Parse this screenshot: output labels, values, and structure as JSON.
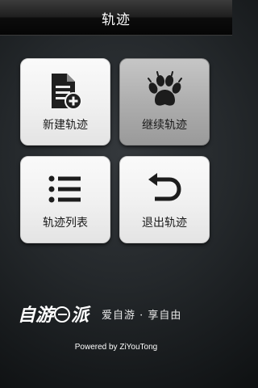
{
  "header": {
    "title": "轨迹"
  },
  "menu": [
    {
      "label": "新建轨迹",
      "icon": "new-document-icon"
    },
    {
      "label": "继续轨迹",
      "icon": "paw-print-icon"
    },
    {
      "label": "轨迹列表",
      "icon": "list-icon"
    },
    {
      "label": "退出轨迹",
      "icon": "return-arrow-icon"
    }
  ],
  "branding": {
    "logo_text_left": "自游",
    "logo_text_right": "派",
    "slogan": "爱自游 · 享自由",
    "powered_by": "Powered by ZiYouTong"
  },
  "colors": {
    "tile_active": "#f2f2f2",
    "tile_pressed": "#acacac",
    "icon": "#1c1c1c"
  }
}
